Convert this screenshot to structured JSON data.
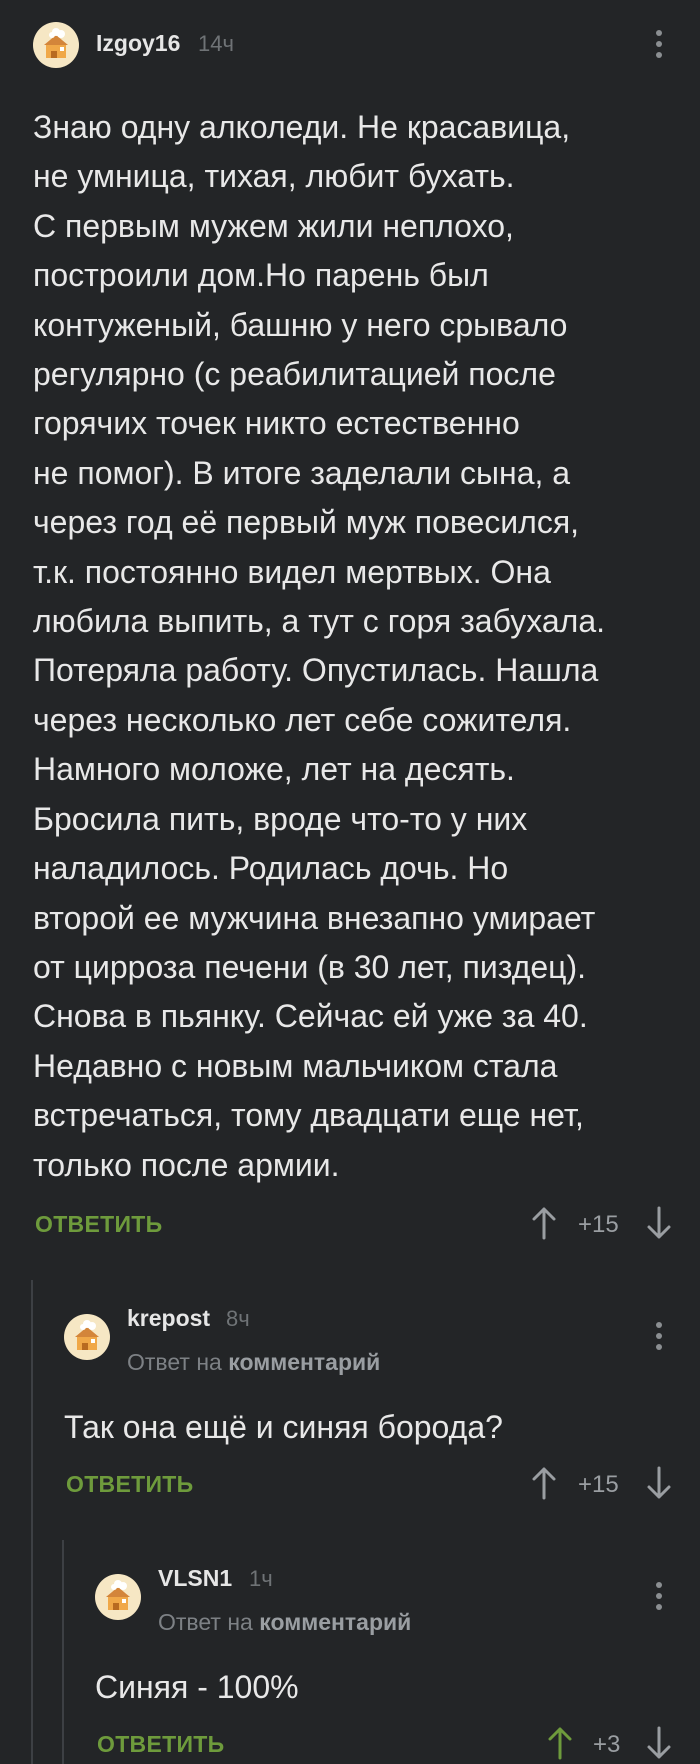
{
  "comments": [
    {
      "author": "Izgoy16",
      "time": "14ч",
      "text": "Знаю одну алколеди. Не красавица,\nне умница, тихая, любит бухать.\nС первым мужем жили неплохо,\nпостроили дом.Но парень был\nконтуженый, башню у него срывало\nрегулярно (с реабилитацией после\nгорячих точек никто естественно\nне помог). В итоге заделали сына, а\nчерез год её первый муж повесился,\nт.к. постоянно видел мертвых. Она\nлюбила выпить, а тут с горя забухала.\nПотеряла работу. Опустилась. Нашла\nчерез несколько лет себе сожителя.\nНамного моложе, лет на десять.\nБросила пить, вроде что-то у них\nналадилось. Родилась дочь. Но\nвторой ее мужчина внезапно умирает\nот цирроза печени (в 30 лет, пиздец).\nСнова в пьянку. Сейчас ей уже за 40.\nНедавно с новым мальчиком стала\nвстречаться, тому двадцати еще нет,\nтолько после армии.",
      "reply_label": "ОТВЕТИТЬ",
      "score": "+15"
    },
    {
      "author": "krepost",
      "time": "8ч",
      "reply_prefix": "Ответ на",
      "reply_target": "комментарий",
      "text": "Так она ещё и синяя борода?",
      "reply_label": "ОТВЕТИТЬ",
      "score": "+15"
    },
    {
      "author": "VLSN1",
      "time": "1ч",
      "reply_prefix": "Ответ на",
      "reply_target": "комментарий",
      "text": "Синяя - 100%",
      "reply_label": "ОТВЕТИТЬ",
      "score": "+3"
    }
  ],
  "icons": {
    "avatar": "default-avatar-icon",
    "more": "more-vertical-icon",
    "up": "arrow-up-icon",
    "down": "arrow-down-icon"
  },
  "colors": {
    "background": "#232527",
    "accent_green": "#6e9b3c",
    "upvoted_arrow": "#6e9b3c"
  }
}
